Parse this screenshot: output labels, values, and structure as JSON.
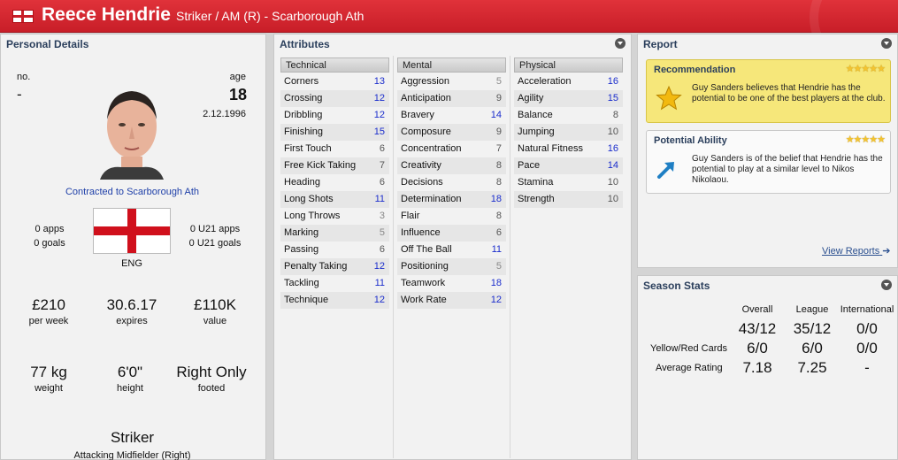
{
  "header": {
    "name": "Reece Hendrie",
    "subtitle": "Striker / AM (R) - Scarborough Ath"
  },
  "personal": {
    "title": "Personal Details",
    "no_label": "no.",
    "no_value": "-",
    "age_label": "age",
    "age_value": "18",
    "dob": "2.12.1996",
    "contract": "Contracted to Scarborough Ath",
    "apps": "0 apps",
    "goals": "0 goals",
    "u21_apps": "0 U21 apps",
    "u21_goals": "0 U21 goals",
    "nation": "ENG",
    "wage_value": "£210",
    "wage_label": "per week",
    "expires_value": "30.6.17",
    "expires_label": "expires",
    "value_value": "£110K",
    "value_label": "value",
    "weight_value": "77 kg",
    "weight_label": "weight",
    "height_value": "6'0\"",
    "height_label": "height",
    "footed_value": "Right Only",
    "footed_label": "footed",
    "position_main": "Striker",
    "position_sub": "Attacking Midfielder (Right)"
  },
  "attributes": {
    "title": "Attributes",
    "technical": {
      "label": "Technical",
      "items": [
        {
          "name": "Corners",
          "value": "13"
        },
        {
          "name": "Crossing",
          "value": "12"
        },
        {
          "name": "Dribbling",
          "value": "12"
        },
        {
          "name": "Finishing",
          "value": "15"
        },
        {
          "name": "First Touch",
          "value": "6"
        },
        {
          "name": "Free Kick Taking",
          "value": "7"
        },
        {
          "name": "Heading",
          "value": "6"
        },
        {
          "name": "Long Shots",
          "value": "11"
        },
        {
          "name": "Long Throws",
          "value": "3"
        },
        {
          "name": "Marking",
          "value": "5"
        },
        {
          "name": "Passing",
          "value": "6"
        },
        {
          "name": "Penalty Taking",
          "value": "12"
        },
        {
          "name": "Tackling",
          "value": "11"
        },
        {
          "name": "Technique",
          "value": "12"
        }
      ]
    },
    "mental": {
      "label": "Mental",
      "items": [
        {
          "name": "Aggression",
          "value": "5"
        },
        {
          "name": "Anticipation",
          "value": "9"
        },
        {
          "name": "Bravery",
          "value": "14"
        },
        {
          "name": "Composure",
          "value": "9"
        },
        {
          "name": "Concentration",
          "value": "7"
        },
        {
          "name": "Creativity",
          "value": "8"
        },
        {
          "name": "Decisions",
          "value": "8"
        },
        {
          "name": "Determination",
          "value": "18"
        },
        {
          "name": "Flair",
          "value": "8"
        },
        {
          "name": "Influence",
          "value": "6"
        },
        {
          "name": "Off The Ball",
          "value": "11"
        },
        {
          "name": "Positioning",
          "value": "5"
        },
        {
          "name": "Teamwork",
          "value": "18"
        },
        {
          "name": "Work Rate",
          "value": "12"
        }
      ]
    },
    "physical": {
      "label": "Physical",
      "items": [
        {
          "name": "Acceleration",
          "value": "16"
        },
        {
          "name": "Agility",
          "value": "15"
        },
        {
          "name": "Balance",
          "value": "8"
        },
        {
          "name": "Jumping",
          "value": "10"
        },
        {
          "name": "Natural Fitness",
          "value": "16"
        },
        {
          "name": "Pace",
          "value": "14"
        },
        {
          "name": "Stamina",
          "value": "10"
        },
        {
          "name": "Strength",
          "value": "10"
        }
      ]
    }
  },
  "report": {
    "title": "Report",
    "recommendation_title": "Recommendation",
    "recommendation_text": "Guy Sanders believes that Hendrie has the potential to be one of the best players at the club.",
    "recommendation_stars": "★★★★★",
    "potential_title": "Potential Ability",
    "potential_text": "Guy Sanders is of the belief that Hendrie has the potential to play at a similar level to Nikos Nikolaou.",
    "potential_stars": "★★★★★",
    "view_reports": "View Reports"
  },
  "season": {
    "title": "Season Stats",
    "headers": [
      "Overall",
      "League",
      "International"
    ],
    "rows": [
      {
        "label": "",
        "values": [
          "43/12",
          "35/12",
          "0/0"
        ]
      },
      {
        "label": "Yellow/Red Cards",
        "values": [
          "6/0",
          "6/0",
          "0/0"
        ]
      },
      {
        "label": "Average Rating",
        "values": [
          "7.18",
          "7.25",
          "-"
        ]
      }
    ]
  },
  "colors": {
    "header_red": "#d42832",
    "title_blue": "#2b3f5c",
    "value_blue": "#1a2ccc",
    "value_grey": "#555555",
    "value_dim": "#888888",
    "recommendation_bg": "#f6e77a",
    "link_blue": "#2a4f8f"
  }
}
